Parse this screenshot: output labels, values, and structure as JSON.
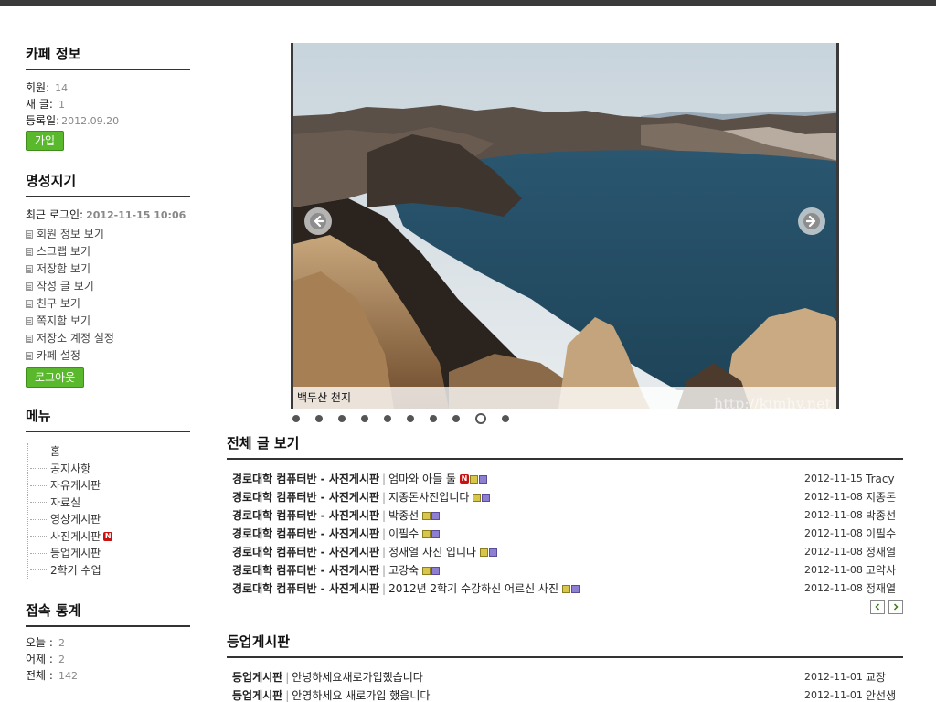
{
  "sidebar": {
    "cafe_info": {
      "title": "카페 정보",
      "members_label": "회원:",
      "members_value": "14",
      "new_posts_label": "새 글:",
      "new_posts_value": "1",
      "registered_label": "등록일:",
      "registered_value": "2012.09.20",
      "join_button": "가입"
    },
    "profile": {
      "title": "명성지기",
      "last_login_label": "최근 로그인:",
      "last_login_value": "2012-11-15 10:06",
      "links": [
        "회원 정보 보기",
        "스크랩 보기",
        "저장함 보기",
        "작성 글 보기",
        "친구 보기",
        "쪽지함 보기",
        "저장소 계정 설정",
        "카페 설정"
      ],
      "logout_button": "로그아웃"
    },
    "menu": {
      "title": "메뉴",
      "items": [
        "홈",
        "공지사항",
        "자유게시판",
        "자료실",
        "영상게시판",
        "사진게시판",
        "등업게시판",
        "2학기 수업"
      ],
      "new_badge": "N"
    },
    "stats": {
      "title": "접속 통계",
      "today_label": "오늘 :",
      "today_value": "2",
      "yesterday_label": "어제 :",
      "yesterday_value": "2",
      "total_label": "전체 :",
      "total_value": "142"
    }
  },
  "slider": {
    "caption": "백두산 천지",
    "watermark": "http://kimhy.net",
    "slide_count": 10,
    "active_index": 8
  },
  "all_posts": {
    "title": "전체 글 보기",
    "posts": [
      {
        "board": "경로대학 컴퓨터반 - 사진게시판",
        "title": "엄마와 아들 둘",
        "date": "2012-11-15",
        "author": "Tracy"
      },
      {
        "board": "경로대학 컴퓨터반 - 사진게시판",
        "title": "지종돈사진입니다",
        "date": "2012-11-08",
        "author": "지종돈"
      },
      {
        "board": "경로대학 컴퓨터반 - 사진게시판",
        "title": "박종선",
        "date": "2012-11-08",
        "author": "박종선"
      },
      {
        "board": "경로대학 컴퓨터반 - 사진게시판",
        "title": "이필수",
        "date": "2012-11-08",
        "author": "이필수"
      },
      {
        "board": "경로대학 컴퓨터반 - 사진게시판",
        "title": "정재열 사진 입니다",
        "date": "2012-11-08",
        "author": "정재열"
      },
      {
        "board": "경로대학 컴퓨터반 - 사진게시판",
        "title": "고강숙",
        "date": "2012-11-08",
        "author": "고약사"
      },
      {
        "board": "경로대학 컴퓨터반 - 사진게시판",
        "title": "2012년 2학기 수강하신 어르신 사진",
        "date": "2012-11-08",
        "author": "정재열"
      }
    ]
  },
  "levelup_board": {
    "title": "등업게시판",
    "posts": [
      {
        "board": "등업게시판",
        "title": "안녕하세요새로가입했습니다",
        "date": "2012-11-01",
        "author": "교장"
      },
      {
        "board": "등업게시판",
        "title": "안영하세요 새로가입 했읍니다",
        "date": "2012-11-01",
        "author": "안선생"
      }
    ]
  }
}
